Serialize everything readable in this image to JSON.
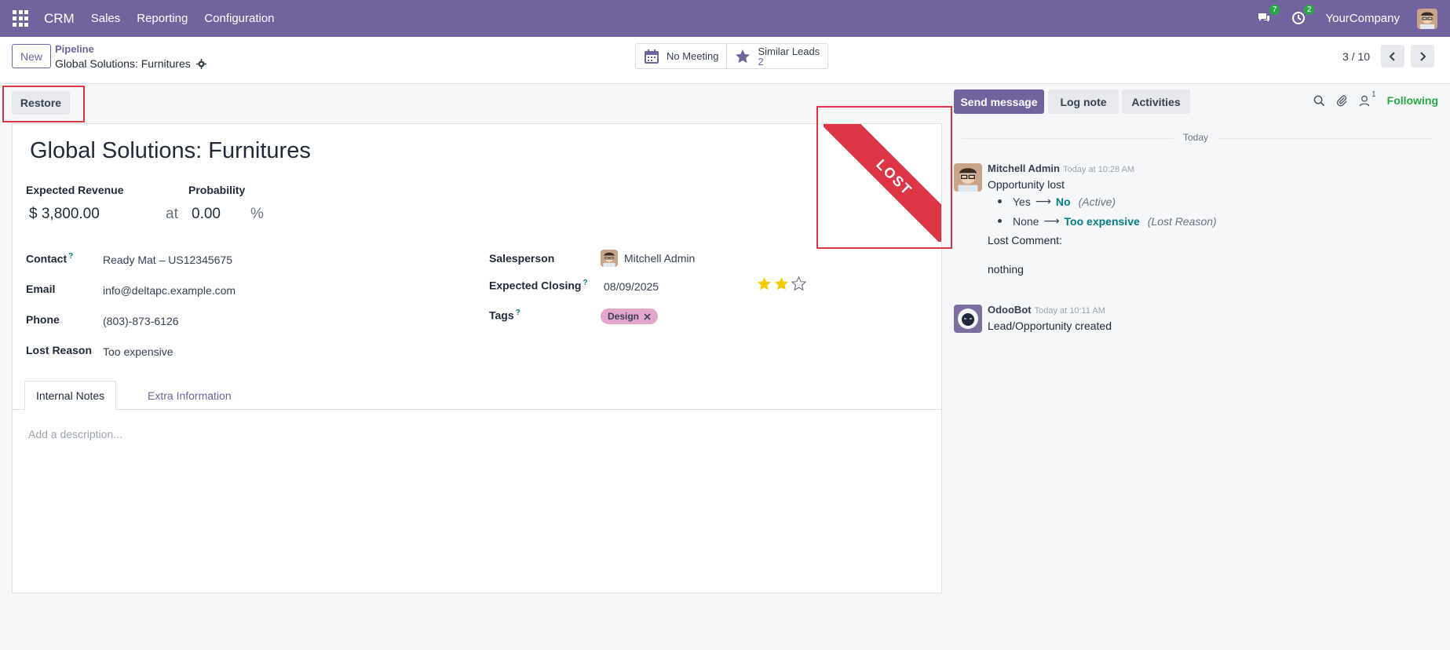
{
  "navbar": {
    "brand": "CRM",
    "menu": [
      "Sales",
      "Reporting",
      "Configuration"
    ],
    "messages_badge": "7",
    "activities_badge": "2",
    "company": "YourCompany"
  },
  "control": {
    "new_label": "New",
    "breadcrumb_parent": "Pipeline",
    "breadcrumb_current": "Global Solutions: Furnitures",
    "smart_meeting": "No Meeting",
    "smart_similar_label": "Similar Leads",
    "smart_similar_count": "2",
    "pager": "3 / 10"
  },
  "statusbar": {
    "restore_label": "Restore"
  },
  "form": {
    "ribbon": "LOST",
    "title": "Global Solutions: Furnitures",
    "expected_revenue_label": "Expected Revenue",
    "expected_revenue": "$ 3,800.00",
    "at_label": "at",
    "probability_label": "Probability",
    "probability": "0.00",
    "percent": "%",
    "contact_label": "Contact",
    "contact": "Ready Mat – US12345675",
    "email_label": "Email",
    "email": "info@deltapc.example.com",
    "phone_label": "Phone",
    "phone": "(803)-873-6126",
    "lost_reason_label": "Lost Reason",
    "lost_reason": "Too expensive",
    "salesperson_label": "Salesperson",
    "salesperson": "Mitchell Admin",
    "expected_closing_label": "Expected Closing",
    "expected_closing": "08/09/2025",
    "priority_stars": 2,
    "priority_max": 3,
    "tags_label": "Tags",
    "tag": "Design",
    "help_mark": "?",
    "tabs": [
      "Internal Notes",
      "Extra Information"
    ],
    "description_placeholder": "Add a description..."
  },
  "chatter": {
    "send_message": "Send message",
    "log_note": "Log note",
    "activities": "Activities",
    "followers_count": "1",
    "following": "Following",
    "date_separator": "Today",
    "messages": [
      {
        "author": "Mitchell Admin",
        "time": "Today at 10:28 AM",
        "body": "Opportunity lost",
        "tracking": [
          {
            "old": "Yes",
            "new": "No",
            "field": "(Active)"
          },
          {
            "old": "None",
            "new": "Too expensive",
            "field": "(Lost Reason)"
          }
        ],
        "comment_label": "Lost Comment:",
        "comment": "nothing"
      },
      {
        "author": "OdooBot",
        "time": "Today at 10:11 AM",
        "body": "Lead/Opportunity created"
      }
    ]
  },
  "colors": {
    "brand": "#71639e",
    "ribbon": "#dc3545",
    "link": "#017e84",
    "following": "#28a745",
    "tag": "#e3a6cd"
  }
}
